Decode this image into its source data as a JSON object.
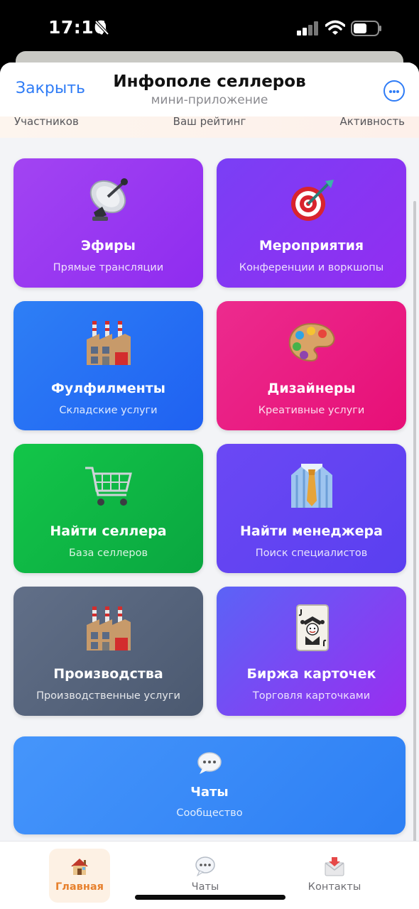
{
  "status_bar": {
    "time": "17:16",
    "icons": [
      "bell-slash-icon",
      "cellular-signal-icon",
      "wifi-icon",
      "battery-icon"
    ]
  },
  "header": {
    "close_label": "Закрыть",
    "title": "Инфополе селлеров",
    "subtitle": "мини-приложение",
    "more_icon": "more-icon"
  },
  "stats": {
    "participants": "Участников",
    "rating": "Ваш рейтинг",
    "activity": "Активность"
  },
  "cards": [
    {
      "title": "Эфиры",
      "subtitle": "Прямые трансляции",
      "icon": "satellite-dish-icon",
      "color_from": "#a244f2",
      "color_to": "#8f2cf0"
    },
    {
      "title": "Мероприятия",
      "subtitle": "Конференции и воркшопы",
      "icon": "target-icon",
      "color_from": "#7a3ff5",
      "color_to": "#922df1"
    },
    {
      "title": "Фулфилменты",
      "subtitle": "Складские услуги",
      "icon": "factory-icon",
      "color_from": "#2e7ff5",
      "color_to": "#1f61f2"
    },
    {
      "title": "Дизайнеры",
      "subtitle": "Креативные услуги",
      "icon": "palette-icon",
      "color_from": "#ec2b8e",
      "color_to": "#e70f77"
    },
    {
      "title": "Найти селлера",
      "subtitle": "База селлеров",
      "icon": "shopping-cart-icon",
      "color_from": "#13c649",
      "color_to": "#0aa640"
    },
    {
      "title": "Найти менеджера",
      "subtitle": "Поиск специалистов",
      "icon": "shirt-tie-icon",
      "color_from": "#6b48f4",
      "color_to": "#5a3ff0"
    },
    {
      "title": "Производства",
      "subtitle": "Производственные услуги",
      "icon": "factory-icon",
      "color_from": "#616f88",
      "color_to": "#4b5970"
    },
    {
      "title": "Биржа карточек",
      "subtitle": "Торговля карточками",
      "icon": "joker-card-icon",
      "color_from": "#5b63f6",
      "color_to": "#9a2df0"
    },
    {
      "title": "Чаты",
      "subtitle": "Сообщество",
      "icon": "speech-bubble-icon",
      "color_from": "#4595fb",
      "color_to": "#2d7ff4"
    }
  ],
  "tab_bar": {
    "active_tab": "Главная",
    "tabs": [
      {
        "label": "Главная",
        "icon": "house-icon"
      },
      {
        "label": "Чаты",
        "icon": "speech-bubble-icon"
      },
      {
        "label": "Контакты",
        "icon": "envelope-icon"
      }
    ]
  },
  "colors": {
    "accent": "#2f7cf6",
    "active_tab": "#e7812e",
    "active_tab_bg": "#fdf1e4"
  }
}
